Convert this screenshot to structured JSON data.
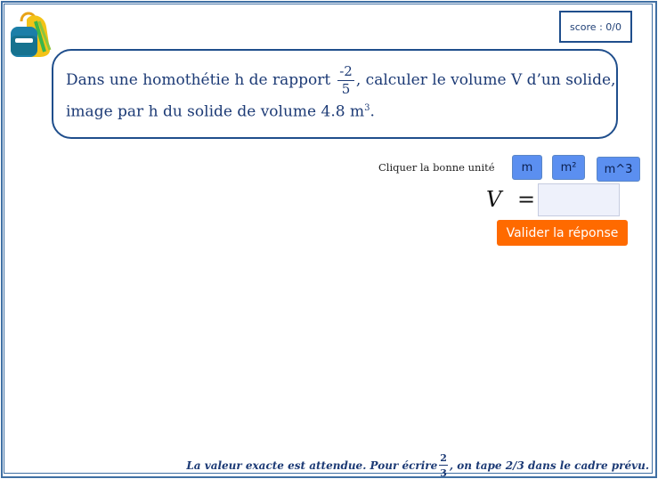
{
  "score": {
    "label": "score : 0/0"
  },
  "question": {
    "text_before": "Dans une homothétie h de rapport",
    "ratio_num": "-2",
    "ratio_den": "5",
    "text_after": ", calculer le volume V d’un solide,",
    "line2_before": "image par h du solide de volume 4.8 m",
    "line2_exp": "3",
    "line2_after": "."
  },
  "units": {
    "label": "Cliquer la bonne unité",
    "buttons": [
      "m",
      "m²",
      "m^3"
    ]
  },
  "answer": {
    "variable": "V",
    "equals": "=",
    "value": "",
    "submit_label": "Valider la réponse"
  },
  "footer": {
    "text_before": "La valeur exacte est attendue. Pour écrire",
    "frac_num": "2",
    "frac_den": "3",
    "text_after": ", on tape 2/3 dans le cadre prévu."
  },
  "colors": {
    "accent": "#1f4e8c",
    "button": "#5b8ff0",
    "submit": "#ff6a00"
  },
  "icons": {
    "logo": "backpack-icon"
  }
}
